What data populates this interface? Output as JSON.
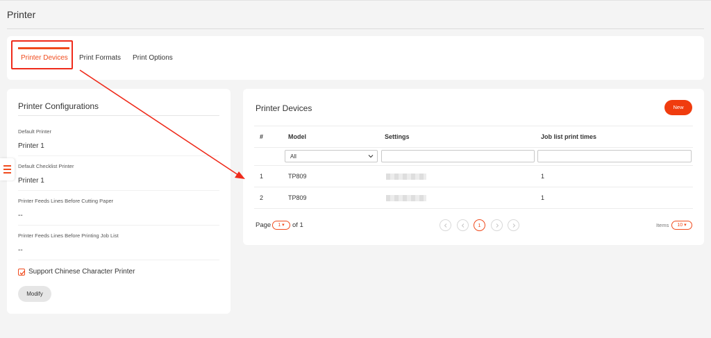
{
  "page": {
    "title": "Printer"
  },
  "tabs": [
    {
      "label": "Printer Devices",
      "active": true
    },
    {
      "label": "Print Formats",
      "active": false
    },
    {
      "label": "Print Options",
      "active": false
    }
  ],
  "config": {
    "title": "Printer Configurations",
    "fields": [
      {
        "label": "Default Printer",
        "value": "Printer 1"
      },
      {
        "label": "Default Checklist Printer",
        "value": "Printer 1"
      },
      {
        "label": "Printer Feeds Lines Before Cutting Paper",
        "value": "--"
      },
      {
        "label": "Printer Feeds Lines Before Printing Job List",
        "value": "--"
      }
    ],
    "checkbox_label": "Support Chinese Character Printer",
    "checkbox_checked": true,
    "modify_label": "Modify"
  },
  "devices": {
    "title": "Printer Devices",
    "new_label": "New",
    "columns": [
      "#",
      "Model",
      "Settings",
      "Job list print times"
    ],
    "model_filter": "All",
    "rows": [
      {
        "num": "1",
        "model": "TP809",
        "times": "1"
      },
      {
        "num": "2",
        "model": "TP809",
        "times": "1"
      }
    ],
    "pager": {
      "page_label": "Page",
      "current_page": "1",
      "of_label": "of 1",
      "active_page": "1",
      "items_label": "Items",
      "page_size": "10"
    }
  },
  "colors": {
    "accent": "#f04a1c",
    "annotation": "#ef2a1a"
  },
  "icons": [
    "hamburger-menu-icon",
    "chevron-down-icon",
    "checkmark-icon",
    "first-page-icon",
    "prev-page-icon",
    "next-page-icon",
    "last-page-icon",
    "annotation-arrow"
  ]
}
